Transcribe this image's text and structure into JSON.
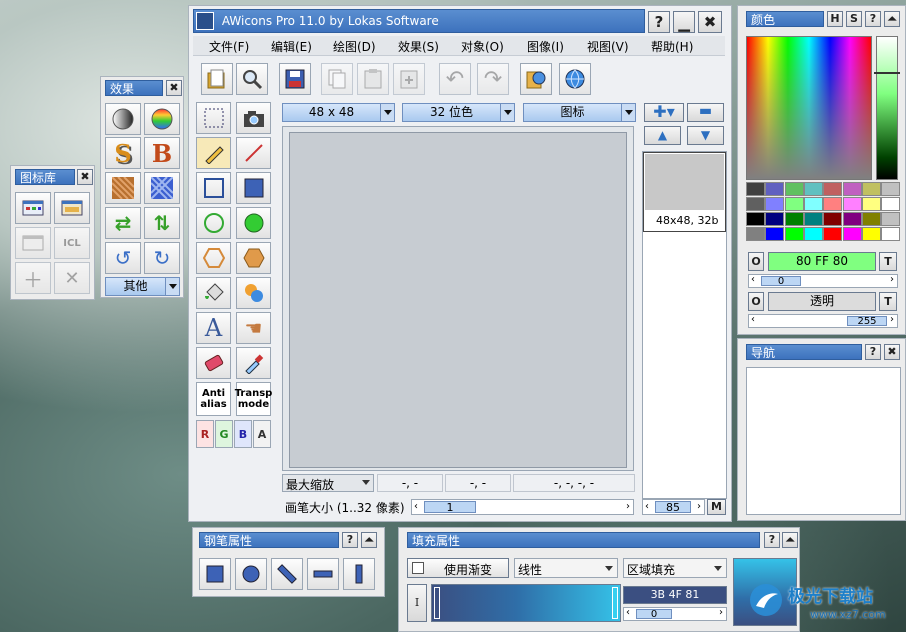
{
  "main_window": {
    "title": "AWicons Pro 11.0 by Lokas Software",
    "menu": [
      "文件(F)",
      "编辑(E)",
      "绘图(D)",
      "效果(S)",
      "对象(O)",
      "图像(I)",
      "视图(V)",
      "帮助(H)"
    ],
    "icon_size": "48 x 48",
    "color_depth": "32 位色",
    "format": "图标",
    "preview_caption": "48x48, 32b",
    "zoom_select": "最大缩放",
    "coord1": "-, -",
    "coord2": "-, -",
    "coord3": "-, -, -, -",
    "pen_size_label": "画笔大小 (1..32 像素)",
    "pen_size_value": "1",
    "list_scroll_value": "85",
    "list_m_label": "M",
    "tool_antialias": "Anti\nalias",
    "tool_antialias_1": "Anti",
    "tool_antialias_2": "alias",
    "tool_transp_1": "Transp",
    "tool_transp_2": "mode",
    "channel_r": "R",
    "channel_g": "G",
    "channel_b": "B",
    "channel_a": "A"
  },
  "effects_panel": {
    "title": "效果",
    "other_label": "其他"
  },
  "library_panel": {
    "title": "图标库"
  },
  "color_panel": {
    "title": "颜色",
    "fg_label": "O",
    "fg_value": "80 FF 80",
    "fg_t": "T",
    "fg_slider": "0",
    "bg_label": "O",
    "bg_value": "透明",
    "bg_t": "T",
    "bg_slider": "255",
    "colors": {
      "foreground": "#80FF80"
    },
    "palette": [
      [
        "#404040",
        "#6060c0",
        "#60c060",
        "#60c0c0",
        "#c06060",
        "#c060c0",
        "#c0c060",
        "#c0c0c0"
      ],
      [
        "#606060",
        "#8080ff",
        "#80ff80",
        "#80ffff",
        "#ff8080",
        "#ff80ff",
        "#ffff80",
        "#ffffff"
      ],
      [
        "#000000",
        "#000080",
        "#008000",
        "#008080",
        "#800000",
        "#800080",
        "#808000",
        "#c0c0c0"
      ],
      [
        "#808080",
        "#0000ff",
        "#00ff00",
        "#00ffff",
        "#ff0000",
        "#ff00ff",
        "#ffff00",
        "#ffffff"
      ]
    ]
  },
  "navigator_panel": {
    "title": "导航"
  },
  "pen_props_panel": {
    "title": "钢笔属性"
  },
  "fill_props_panel": {
    "title": "填充属性",
    "use_gradient": "使用渐变",
    "gradient_type": "线性",
    "fill_mode": "区域填充",
    "i_label": "I",
    "color_value": "3B 4F 81",
    "slider_value": "0"
  },
  "watermark": {
    "text": "极光下载站",
    "url": "www.xz7.com"
  }
}
